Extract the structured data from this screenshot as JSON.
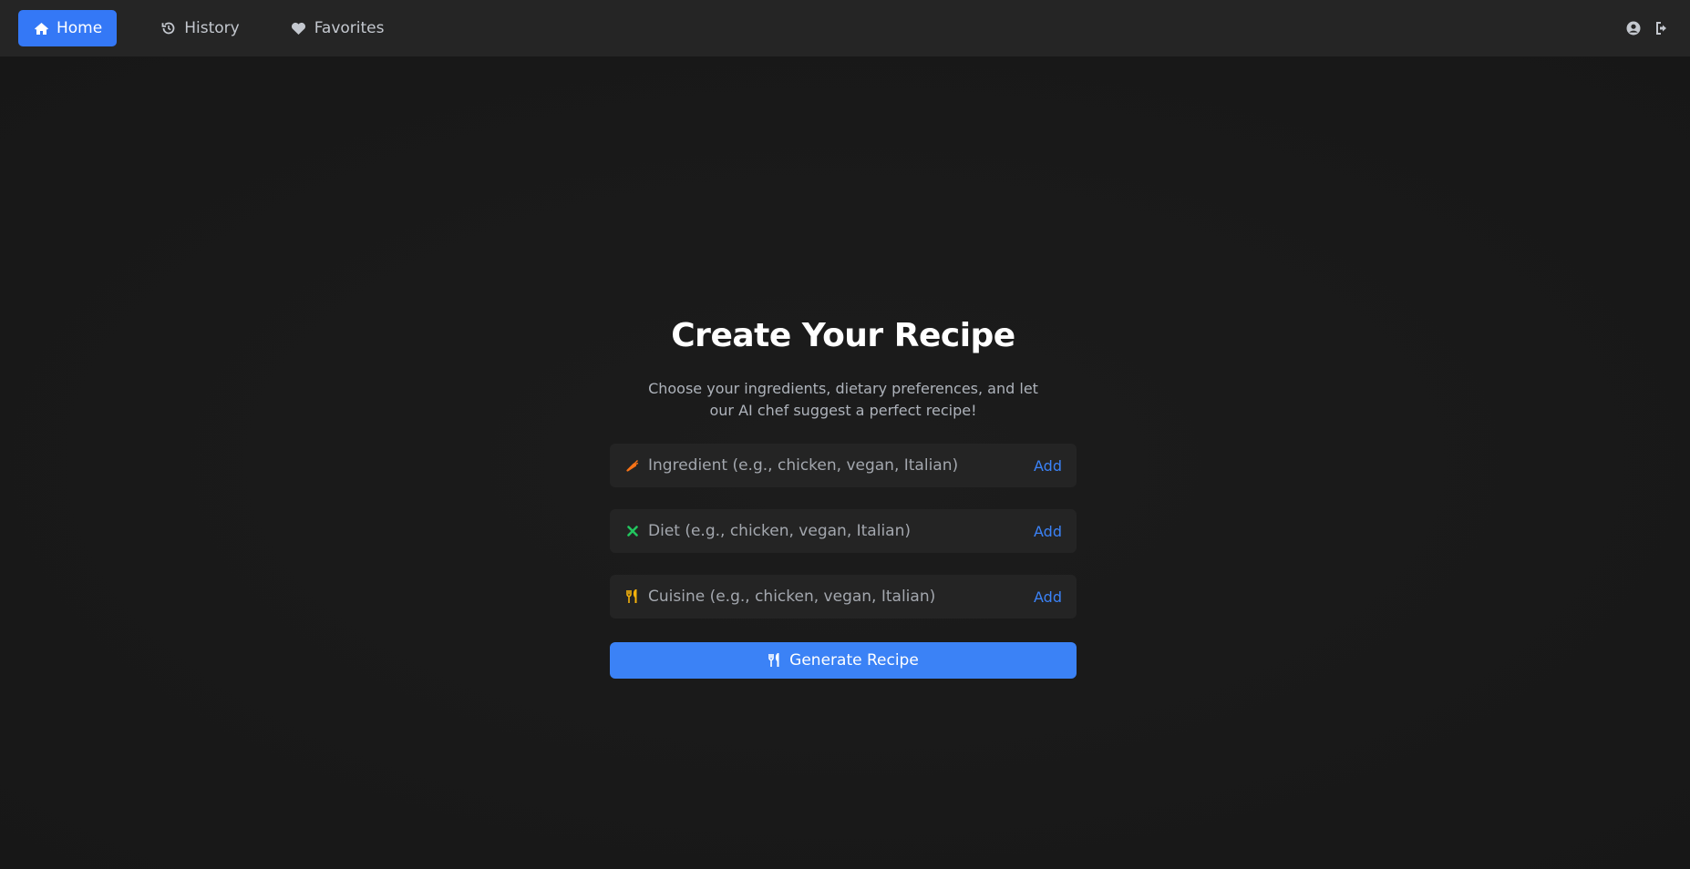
{
  "nav": {
    "items": [
      {
        "label": "Home",
        "icon": "home-icon",
        "active": true
      },
      {
        "label": "History",
        "icon": "history-icon",
        "active": false
      },
      {
        "label": "Favorites",
        "icon": "heart-icon",
        "active": false
      }
    ],
    "right_icons": [
      "user-circle-icon",
      "sign-out-icon"
    ]
  },
  "main": {
    "title": "Create Your Recipe",
    "subtitle": "Choose your ingredients, dietary preferences, and let our AI chef suggest a perfect recipe!",
    "fields": [
      {
        "placeholder": "Ingredient (e.g., chicken, vegan, Italian)",
        "value": "",
        "icon": "carrot-icon",
        "add_label": "Add"
      },
      {
        "placeholder": "Diet (e.g., chicken, vegan, Italian)",
        "value": "",
        "icon": "x-icon",
        "add_label": "Add"
      },
      {
        "placeholder": "Cuisine (e.g., chicken, vegan, Italian)",
        "value": "",
        "icon": "utensils-icon",
        "add_label": "Add"
      }
    ],
    "generate_label": "Generate Recipe"
  },
  "colors": {
    "accent": "#3478f6",
    "background": "#1a1a1a",
    "navbar": "#252525",
    "field_bg": "#242424",
    "carrot": "#f97316",
    "diet_x": "#22c55e",
    "utensils": "#f5b20b"
  }
}
